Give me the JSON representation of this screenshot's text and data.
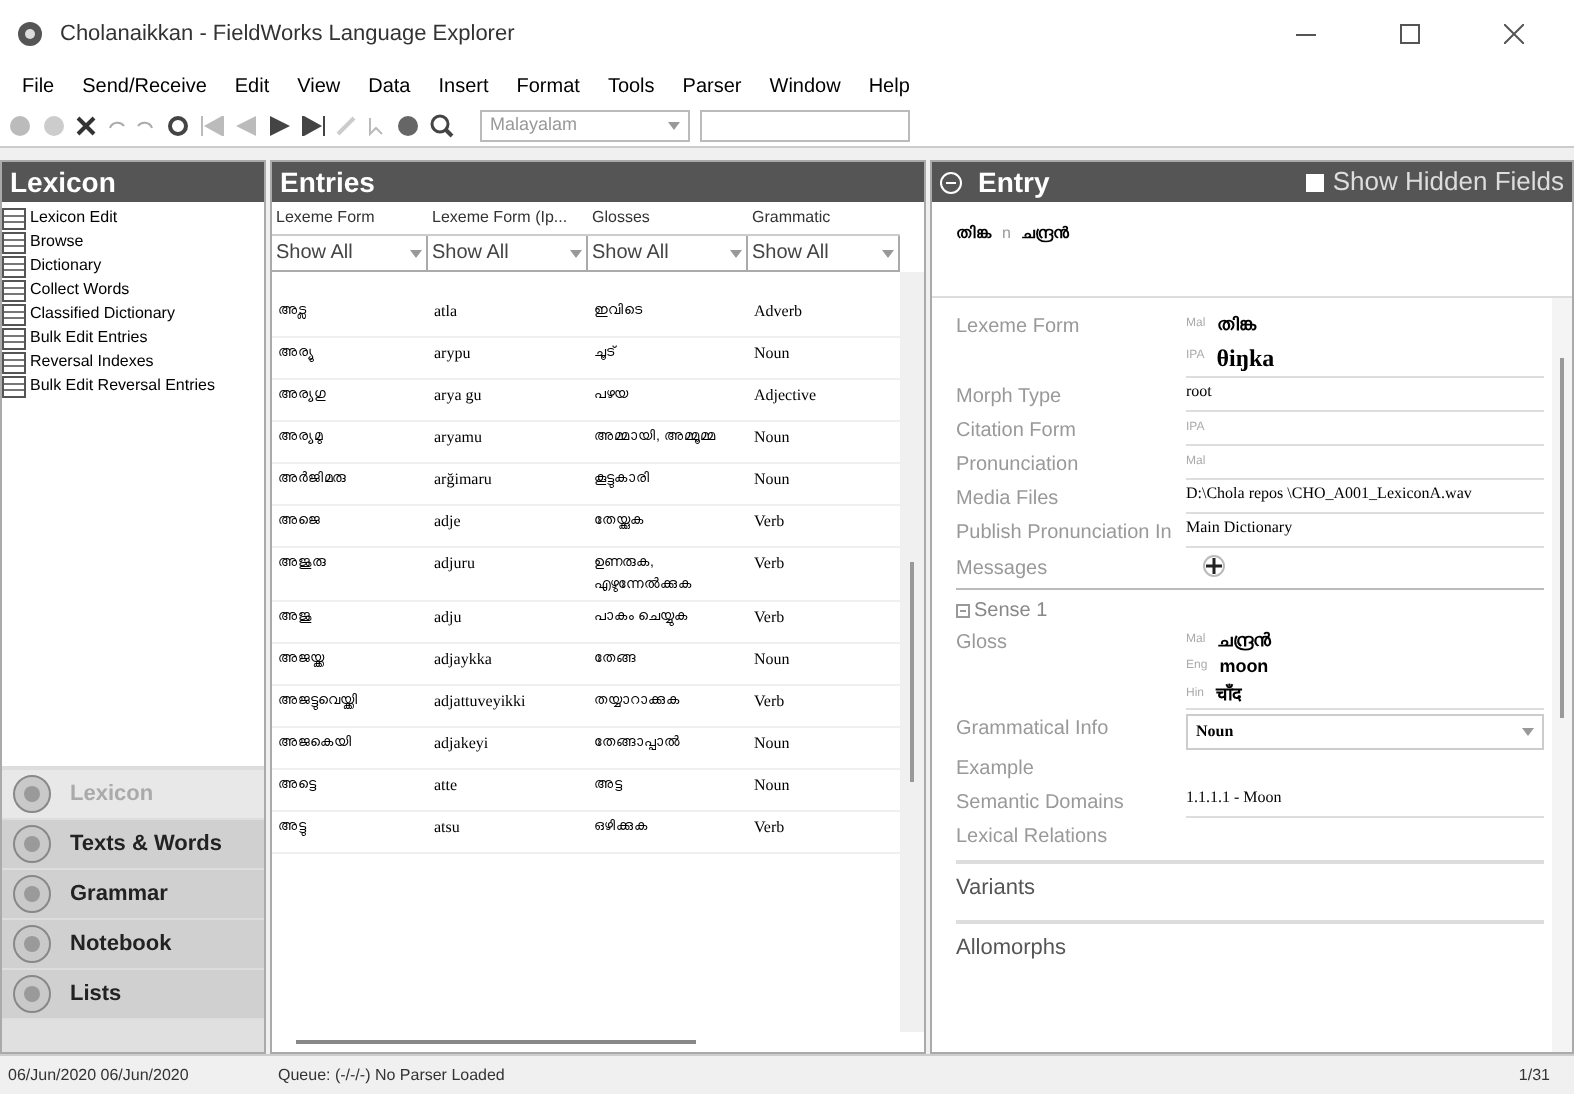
{
  "window": {
    "title": "Cholanaikkan - FieldWorks Language Explorer"
  },
  "menu": [
    "File",
    "Send/Receive",
    "Edit",
    "View",
    "Data",
    "Insert",
    "Format",
    "Tools",
    "Parser",
    "Window",
    "Help"
  ],
  "toolbar": {
    "writing_system": "Malayalam"
  },
  "sidebar": {
    "title": "Lexicon",
    "tools": [
      {
        "label": "Lexicon Edit",
        "selected": false
      },
      {
        "label": "Browse",
        "selected": false
      },
      {
        "label": "Dictionary",
        "selected": false
      },
      {
        "label": "Collect Words",
        "selected": false
      },
      {
        "label": "Classified Dictionary",
        "selected": false
      },
      {
        "label": "Bulk Edit Entries",
        "selected": false
      },
      {
        "label": "Reversal Indexes",
        "selected": false
      },
      {
        "label": "Bulk Edit Reversal Entries",
        "selected": false
      }
    ],
    "areas": [
      {
        "label": "Lexicon",
        "selected": true
      },
      {
        "label": "Texts & Words",
        "selected": false
      },
      {
        "label": "Grammar",
        "selected": false
      },
      {
        "label": "Notebook",
        "selected": false
      },
      {
        "label": "Lists",
        "selected": false
      }
    ]
  },
  "entries": {
    "title": "Entries",
    "columns": [
      "Lexeme Form",
      "Lexeme Form (Ip...",
      "Glosses",
      "Grammatic"
    ],
    "filters": [
      "Show All",
      "Show All",
      "Show All",
      "Show All"
    ],
    "rows": [
      [
        "അട്ല",
        "atla",
        "ഇവിടെ",
        "Adverb"
      ],
      [
        "അര്യു",
        "arypu",
        "ചൂട്",
        "Noun"
      ],
      [
        "അര്യഗു",
        "arya gu",
        "പഴയ",
        "Adjective"
      ],
      [
        "അര്യമു",
        "aryamu",
        "അമ്മായി, അമ്മൂമ്മ",
        "Noun"
      ],
      [
        "അർജിമരു",
        "arğimaru",
        "കൂട്ടുകാരി",
        "Noun"
      ],
      [
        "അജെ",
        "adje",
        "തേയ്ക്കുക",
        "Verb"
      ],
      [
        "അജുരു",
        "adjuru",
        "ഉണരുക, എഴുന്നേൽക്കുക",
        "Verb"
      ],
      [
        "അജു",
        "adju",
        "പാകം ചെയ്യുക",
        "Verb"
      ],
      [
        "അജയ്ക്ക",
        "adjaykka",
        "തേങ്ങ",
        "Noun"
      ],
      [
        "അജട്ടുവെയ്ക്കി",
        "adjattuveyikki",
        "തയ്യാറാക്കുക",
        "Verb"
      ],
      [
        "അജകെയി",
        "adjakeyi",
        "തേങ്ങാപ്പാൽ",
        "Noun"
      ],
      [
        "അട്ടെ",
        "atte",
        "അട്ട",
        "Noun"
      ],
      [
        "അട്ടു",
        "atsu",
        "ഒഴിക്കുക",
        "Verb"
      ]
    ]
  },
  "entry": {
    "title": "Entry",
    "show_hidden_fields": {
      "label": "Show Hidden Fields",
      "checked": true
    },
    "headword": [
      {
        "text": "തിങ്ക"
      },
      {
        "text": "n"
      },
      {
        "text": "ചന്ദ്രൻ"
      }
    ],
    "fields": [
      {
        "kind": "multi",
        "label": "Lexeme Form",
        "values": [
          {
            "ws": "Mal",
            "text": "തിങ്ക"
          },
          {
            "ws": "IPA",
            "text": "θiŋka"
          }
        ]
      },
      {
        "kind": "plain",
        "label": "Morph Type",
        "value": "root"
      },
      {
        "kind": "multi",
        "label": "Citation Form",
        "values": [
          {
            "ws": "IPA"
          }
        ]
      },
      {
        "kind": "multi",
        "label": "Pronunciation",
        "values": [
          {
            "ws": "Mal"
          }
        ]
      },
      {
        "kind": "plain",
        "label": "Media Files",
        "value": "D:\\Chola repos \\CHO_A001_LexiconA.wav"
      },
      {
        "kind": "plain",
        "label": "Publish Pronunciation In",
        "value": "Main Dictionary"
      },
      {
        "kind": "icon",
        "label": "Messages"
      },
      {
        "kind": "section",
        "label": "Sense 1"
      },
      {
        "kind": "multi",
        "label": "Gloss",
        "values": [
          {
            "ws": "Mal",
            "text": "ചന്ദ്രൻ"
          },
          {
            "ws": "Eng",
            "text": "moon"
          },
          {
            "ws": "Hin",
            "text": "चाँद"
          }
        ]
      },
      {
        "kind": "combo",
        "label": "Grammatical Info",
        "value": "Noun"
      },
      {
        "kind": "plain",
        "label": "Example"
      },
      {
        "kind": "plain",
        "label": "Semantic Domains",
        "value": "1.1.1.1 - Moon"
      },
      {
        "kind": "plain",
        "label": "Lexical Relations"
      },
      {
        "kind": "header",
        "label": "Variants"
      },
      {
        "kind": "header",
        "label": "Allomorphs"
      }
    ]
  },
  "status_bar": {
    "dates": "06/Jun/2020 06/Jun/2020",
    "parser": "Queue: (-/-/-) No Parser Loaded",
    "record": "1/31"
  }
}
